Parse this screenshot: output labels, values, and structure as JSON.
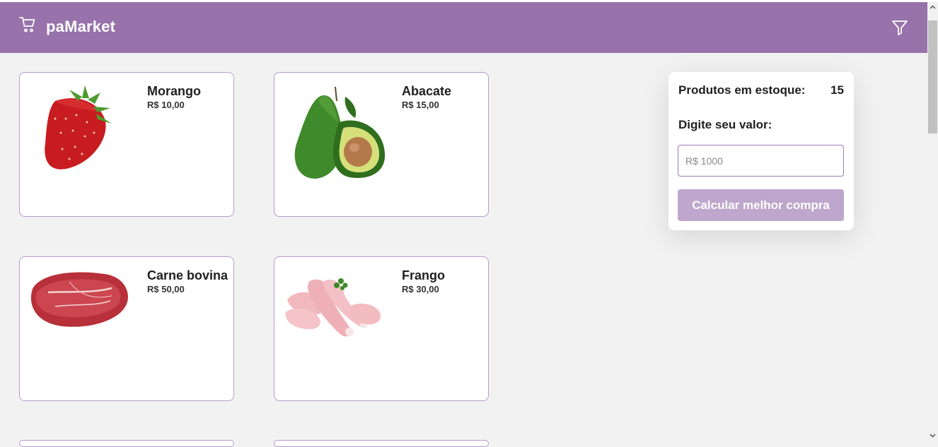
{
  "app": {
    "brand": "paMarket",
    "brand_color": "#9872ab",
    "cart_icon": "cart-icon",
    "filter_icon": "filter-icon"
  },
  "products": [
    {
      "name": "Morango",
      "price": "R$ 10,00",
      "image": "strawberry"
    },
    {
      "name": "Abacate",
      "price": "R$ 15,00",
      "image": "avocado"
    },
    {
      "name": "Carne bovina",
      "price": "R$ 50,00",
      "image": "beef"
    },
    {
      "name": "Frango",
      "price": "R$ 30,00",
      "image": "chicken"
    }
  ],
  "panel": {
    "stock_label": "Produtos em estoque:",
    "stock_value": "15",
    "value_label": "Digite seu valor:",
    "input_placeholder": "R$ 1000",
    "calc_button": "Calcular melhor compra",
    "button_color": "#bea6cc"
  }
}
